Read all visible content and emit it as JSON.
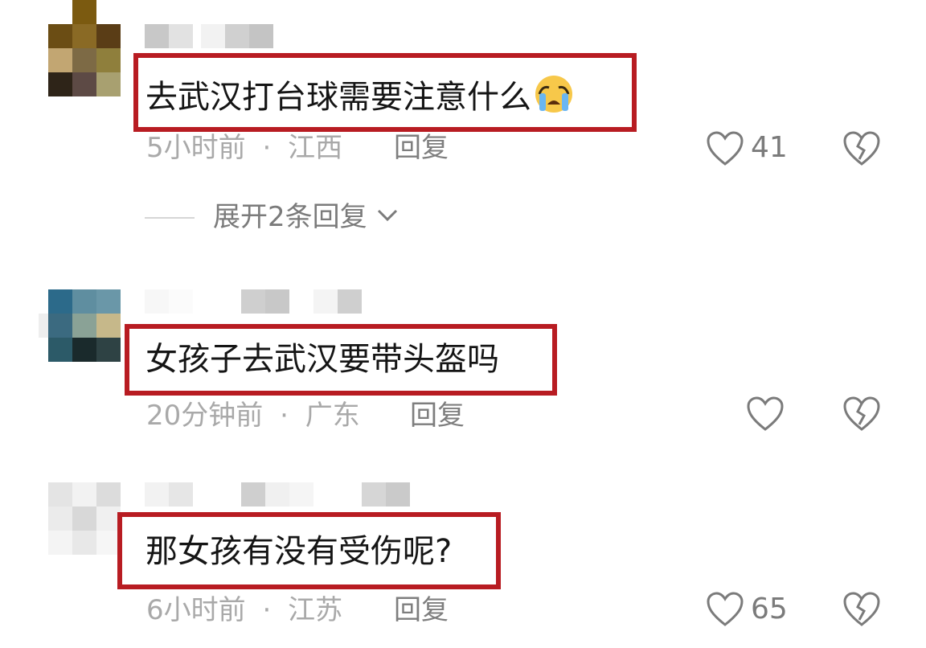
{
  "comments": [
    {
      "text": "去武汉打台球需要注意什么",
      "emoji": "loudly-crying-face",
      "time": "5小时前",
      "location": "江西",
      "reply_label": "回复",
      "like_count": "41",
      "expand_label": "展开2条回复"
    },
    {
      "text": "女孩子去武汉要带头盔吗",
      "time": "20分钟前",
      "location": "广东",
      "reply_label": "回复",
      "like_count": ""
    },
    {
      "text": "那女孩有没有受伤呢?",
      "time": "6小时前",
      "location": "江苏",
      "reply_label": "回复",
      "like_count": "65"
    }
  ],
  "separator": "·",
  "icons": {
    "like": "heart-outline-icon",
    "dislike": "broken-heart-icon",
    "expand": "chevron-down-icon"
  },
  "colors": {
    "highlight_border": "#b81c22",
    "meta_text": "#a9a9a9",
    "reply_text": "#7e7e7e"
  }
}
